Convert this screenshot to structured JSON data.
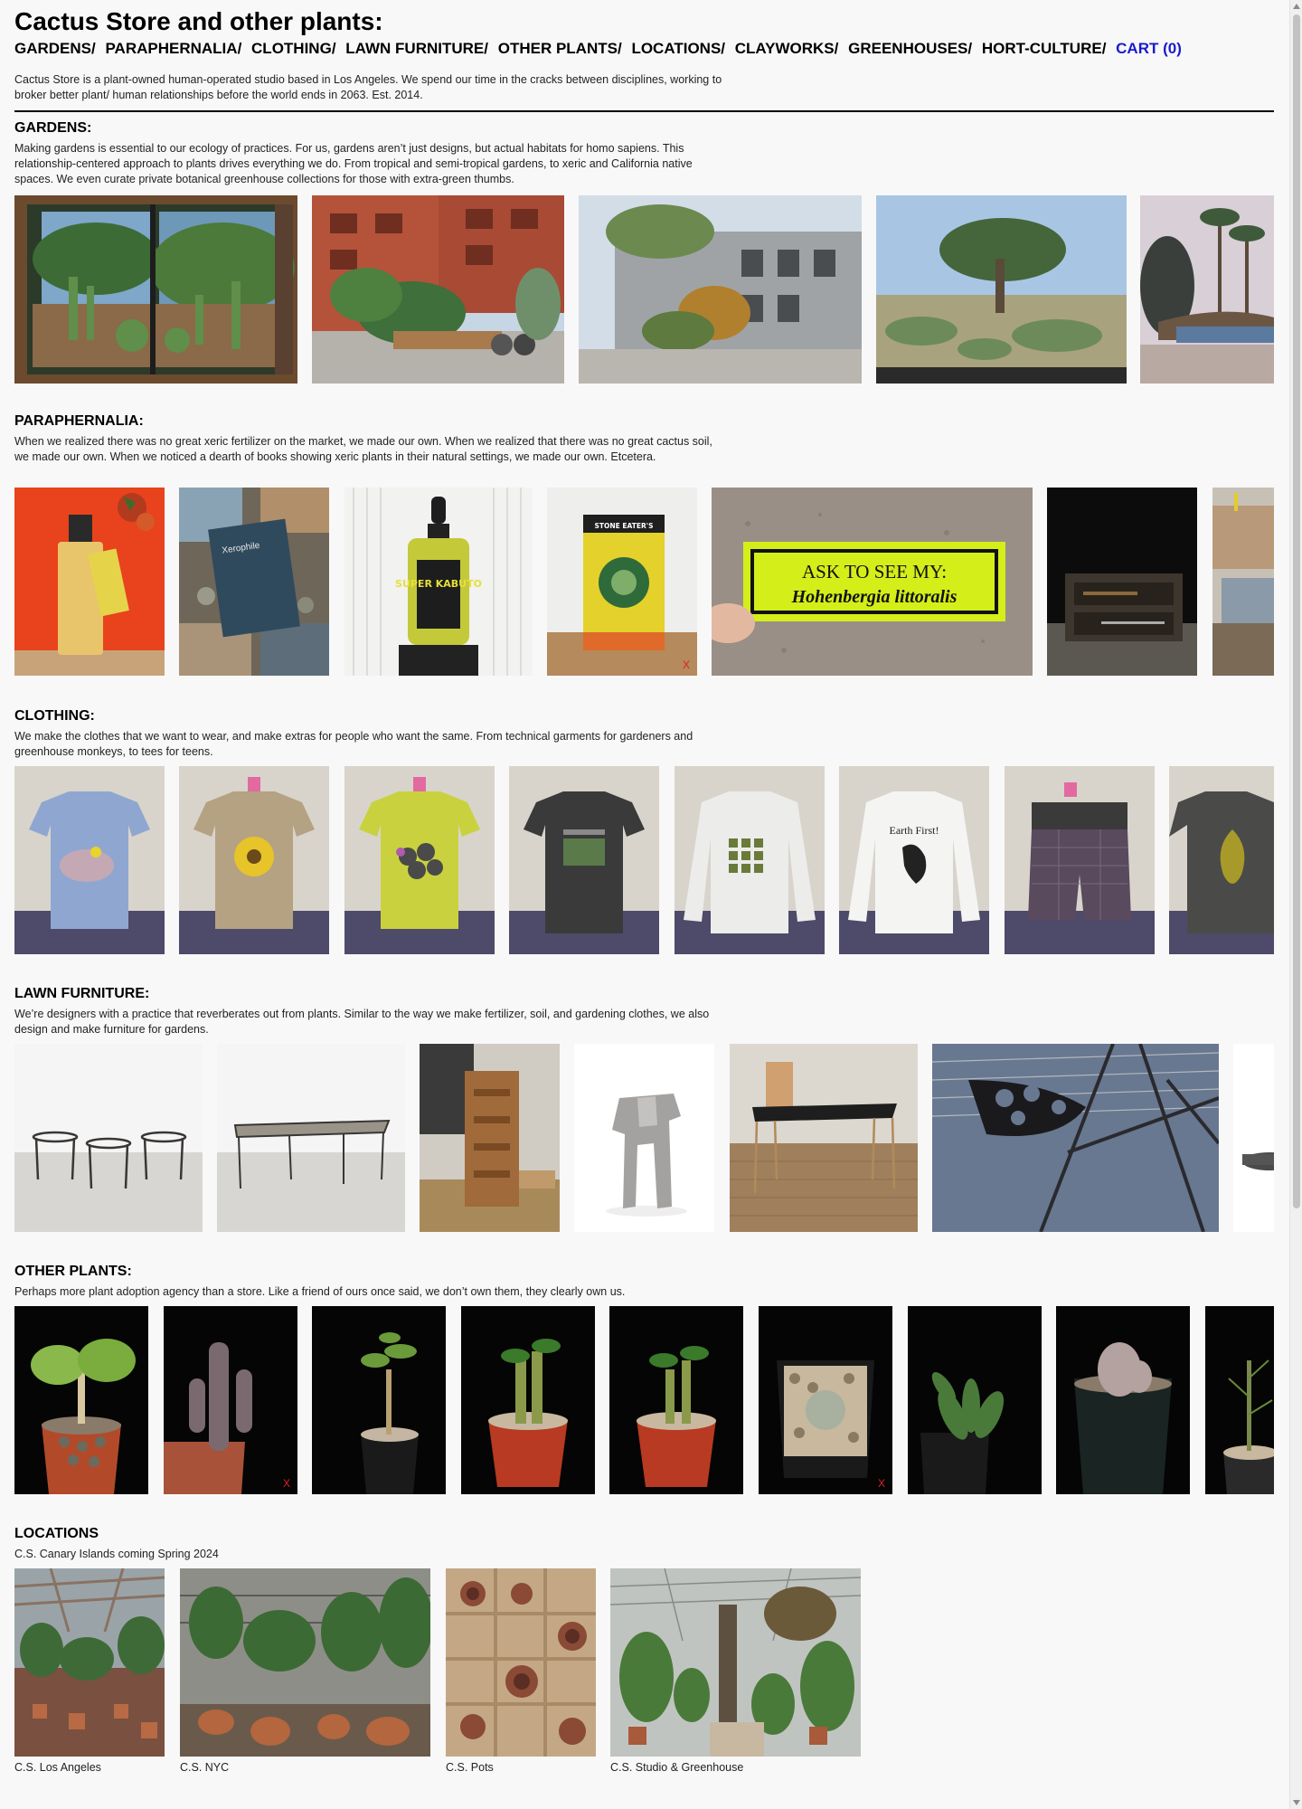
{
  "header": {
    "title": "Cactus Store and other plants:",
    "nav": [
      {
        "label": "GARDENS",
        "sep": "/"
      },
      {
        "label": "PARAPHERNALIA",
        "sep": "/"
      },
      {
        "label": "CLOTHING",
        "sep": "/"
      },
      {
        "label": "LAWN FURNITURE",
        "sep": "/"
      },
      {
        "label": "OTHER PLANTS",
        "sep": "/"
      },
      {
        "label": "LOCATIONS",
        "sep": "/"
      },
      {
        "label": "CLAYWORKS",
        "sep": "/"
      },
      {
        "label": "GREENHOUSES",
        "sep": "/"
      },
      {
        "label": "HORT-CULTURE",
        "sep": "/"
      }
    ],
    "cart_label": "CART (0)",
    "cart_color": "#1a1acc",
    "intro": "Cactus Store is a plant-owned human-operated studio based in Los Angeles. We spend our time in the cracks between disciplines, working to broker better plant/ human relationships before the world ends in 2063. Est. 2014."
  },
  "sections": {
    "gardens": {
      "title": "GARDENS:",
      "desc": "Making gardens is essential to our ecology of practices. For us, gardens aren’t just designs, but actual habitats for homo sapiens. This relationship-centered approach to plants drives everything we do. From tropical and semi-tropical gardens, to xeric and California native spaces. We even curate private botanical greenhouse collections for those with extra-green thumbs."
    },
    "paraphernalia": {
      "title": "PARAPHERNALIA:",
      "desc": "When we realized there was no great xeric fertilizer on the market, we made our own. When we realized that there was no great cactus soil, we made our own. When we noticed a dearth of books showing xeric plants in their natural settings, we made our own. Etcetera.",
      "book_title": "Xerophile",
      "bottle_label": "SUPER KABUTO",
      "box_label": "STONE EATER'S",
      "sign_line1": "ASK TO SEE MY:",
      "sign_line2": "Hohenbergia littoralis"
    },
    "clothing": {
      "title": "CLOTHING:",
      "desc": "We make the clothes that we want to wear, and make extras for people who want the same. From technical garments for gardeners and greenhouse monkeys, to tees for teens.",
      "tee_text": "Earth First!"
    },
    "lawn": {
      "title": "LAWN FURNITURE:",
      "desc": "We’re designers with a practice that reverberates out from plants. Similar to the way we make fertilizer, soil, and gardening clothes, we also design and make furniture for gardens."
    },
    "other": {
      "title": "OTHER PLANTS:",
      "desc": "Perhaps more plant adoption agency than a store. Like a friend of ours once said, we don’t own them, they clearly own us.",
      "sold_mark": "X"
    },
    "locations": {
      "title": "LOCATIONS",
      "desc": "C.S. Canary Islands coming Spring 2024",
      "captions": [
        "C.S. Los Angeles",
        "C.S. NYC",
        "C.S. Pots",
        "C.S. Studio & Greenhouse"
      ]
    }
  }
}
